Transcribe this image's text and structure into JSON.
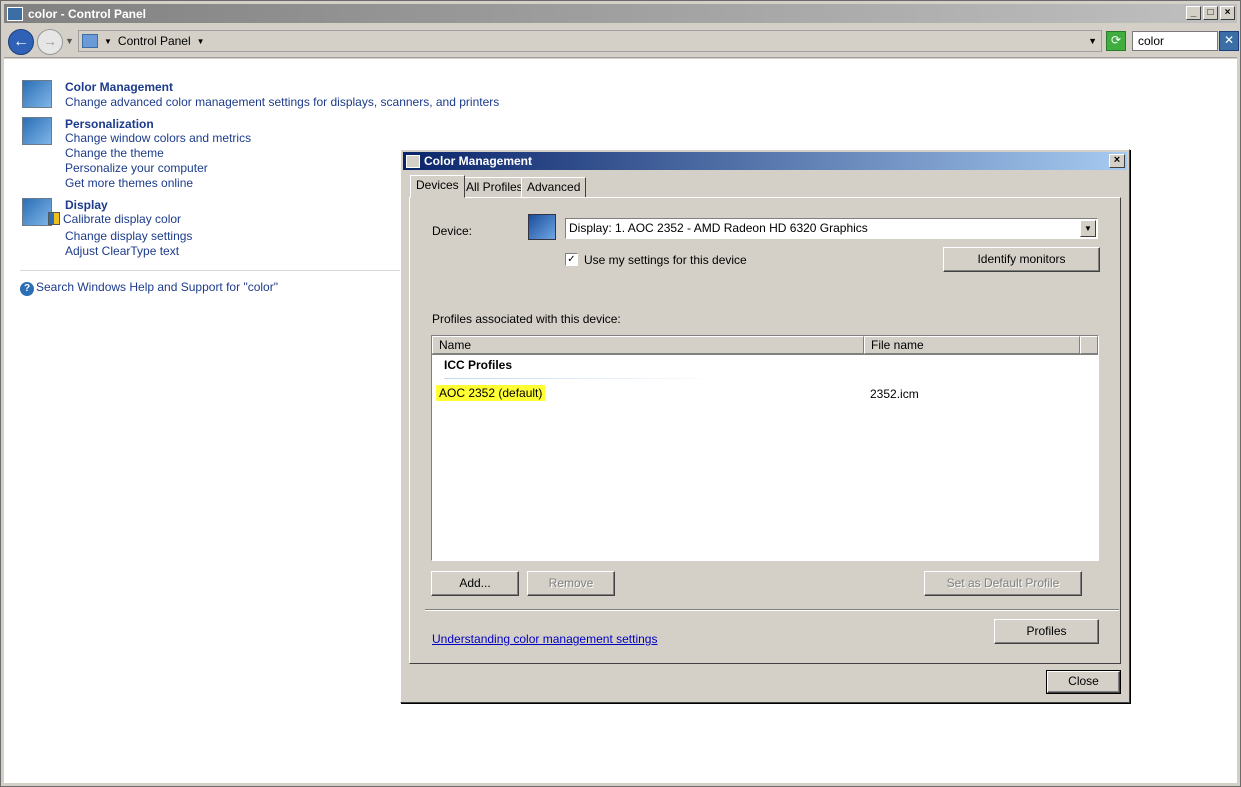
{
  "window": {
    "title": "color - Control Panel",
    "btn_min": "_",
    "btn_max": "□",
    "btn_close": "×"
  },
  "nav": {
    "back_glyph": "←",
    "forward_glyph": "→",
    "breadcrumb": "Control Panel",
    "search_value": "color",
    "refresh_glyph": "⟳",
    "clear_glyph": "✕"
  },
  "results": {
    "color_management": {
      "title": "Color Management",
      "links": [
        "Change advanced color management settings for displays, scanners, and printers"
      ]
    },
    "personalization": {
      "title": "Personalization",
      "links": [
        "Change window colors and metrics",
        "Change the theme",
        "Personalize your computer",
        "Get more themes online"
      ]
    },
    "display": {
      "title": "Display",
      "links": [
        "Calibrate display color",
        "Change display settings",
        "Adjust ClearType text"
      ]
    },
    "help_link": "Search Windows Help and Support for \"color\"",
    "help_glyph": "?"
  },
  "dialog": {
    "title": "Color Management",
    "close_glyph": "×",
    "tabs": [
      "Devices",
      "All Profiles",
      "Advanced"
    ],
    "device_label": "Device:",
    "device_value": "Display: 1. AOC 2352 - AMD Radeon HD 6320 Graphics",
    "dropdown_glyph": "▼",
    "use_settings_label": "Use my settings for this device",
    "use_settings_checked": true,
    "check_glyph": "✓",
    "identify_button": "Identify monitors",
    "profiles_label": "Profiles associated with this device:",
    "columns": [
      "Name",
      "File name"
    ],
    "group_header": "ICC Profiles",
    "profiles": [
      {
        "name": "AOC 2352 (default)",
        "file": "2352.icm",
        "highlight_color": "#ffff33"
      }
    ],
    "add_button": "Add...",
    "remove_button": "Remove",
    "set_default_button": "Set as Default Profile",
    "understanding_link": "Understanding color management settings",
    "profiles_button": "Profiles",
    "close_button": "Close"
  }
}
